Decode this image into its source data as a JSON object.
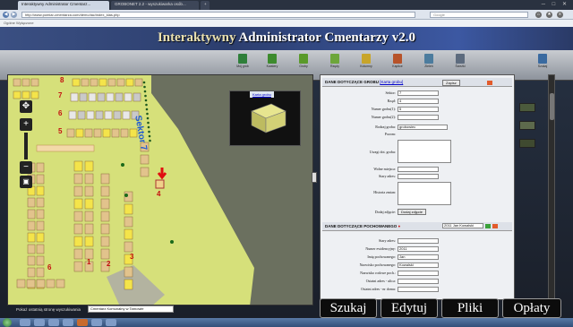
{
  "browser": {
    "tabs": [
      {
        "label": "Interaktywny Administrator Cmentarz..."
      },
      {
        "label": "GROBONET 2.2 - wyszukiwarka osób..."
      },
      {
        "label": "+"
      }
    ],
    "url": "http://www.pomiar-cmentarza.com/demo/iac/index_klas.php",
    "search_placeholder": "Google",
    "bookmarks_text": "Ogólne   Wyłączone"
  },
  "app": {
    "title_word1": "Interaktywny",
    "title_rest": "Administrator Cmentarzy v2.0"
  },
  "toolbar": {
    "tools": [
      {
        "label": "Mój grób",
        "color": "#2f7f3a"
      },
      {
        "label": "Kwatery",
        "color": "#3d8b2e"
      },
      {
        "label": "Groby",
        "color": "#5a9a2a"
      },
      {
        "label": "Rzędy",
        "color": "#6da63a"
      },
      {
        "label": "Kolumny",
        "color": "#c8a52a"
      },
      {
        "label": "Kaplice",
        "color": "#b7532a"
      },
      {
        "label": "Zieleń",
        "color": "#4c7c9e"
      },
      {
        "label": "Ścieżki",
        "color": "#5d6b7e"
      },
      {
        "label": "Szukaj",
        "color": "#3a6aa0"
      }
    ]
  },
  "map": {
    "sector_label": "Sektor 7",
    "quarter_numbers": [
      "8",
      "7",
      "6",
      "5",
      "4",
      "3",
      "2",
      "1",
      "6"
    ],
    "inset_tab": "Karta grobu"
  },
  "form": {
    "grave_section_title": "DANE DOTYCZĄCE GROBU",
    "grave_card_link": "[Karta grobu]",
    "save_btn": "Zapisz",
    "fields": [
      {
        "label": "Sektor:",
        "value": "7"
      },
      {
        "label": "Rząd:",
        "value": "4"
      },
      {
        "label": "Numer grobu(1):",
        "value": "5"
      },
      {
        "label": "Numer grobu(2):",
        "value": ""
      }
    ],
    "grave_type_label": "Rodzaj grobu:",
    "grave_type_value": "grobowiec",
    "position_label": "Pozom:",
    "notes_label": "Uwagi dot. grobu:",
    "free_places_label": "Wolne miejsca:",
    "old_address_label": "Stary adres:",
    "history_label": "Historia zmian:",
    "add_photo_label": "Dodaj zdjęcie:",
    "add_photo_btn": "Dodaj zdjęcie",
    "buried_section_title": "DANE DOTYCZĄCE POCHOWANEGO",
    "person_select": "2011 Jan Kowalski",
    "person_fields": [
      {
        "label": "Stary adres:",
        "value": ""
      },
      {
        "label": "Numer ewidencyjny:",
        "value": "2011"
      },
      {
        "label": "Imię pochowanego:",
        "value": "Jan"
      },
      {
        "label": "Nazwisko pochowanego:",
        "value": "Kowalski"
      },
      {
        "label": "Nazwisko rodowe poch.:",
        "value": ""
      },
      {
        "label": "Ostatni adres - ulica:",
        "value": ""
      },
      {
        "label": "Ostatni adres - nr domu:",
        "value": ""
      }
    ]
  },
  "actions": [
    {
      "label": "Szukaj"
    },
    {
      "label": "Edytuj"
    },
    {
      "label": "Pliki"
    },
    {
      "label": "Opłaty"
    }
  ],
  "bottom": {
    "label": "Pokaż ostatnią stronę wyszukiwania",
    "select_value": "Cmentarz Komunalny w Tarnowie"
  }
}
